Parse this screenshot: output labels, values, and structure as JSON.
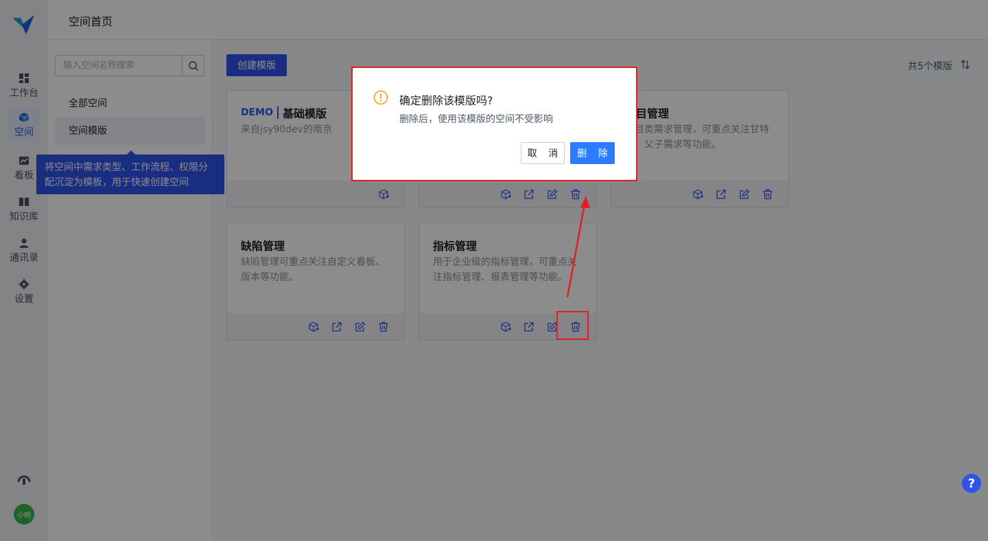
{
  "app": {
    "page_title": "空间首页",
    "avatar_text": "小明"
  },
  "nav": [
    {
      "label": "工作台",
      "icon": "dashboard-icon"
    },
    {
      "label": "空间",
      "icon": "cube-icon",
      "active": true
    },
    {
      "label": "看板",
      "icon": "board-icon"
    },
    {
      "label": "知识库",
      "icon": "book-icon"
    },
    {
      "label": "通讯录",
      "icon": "contacts-icon"
    },
    {
      "label": "设置",
      "icon": "settings-icon"
    }
  ],
  "sidebar": {
    "search_placeholder": "输入空间名称搜索",
    "items": [
      {
        "label": "全部空间"
      },
      {
        "label": "空间模版",
        "active": true
      }
    ]
  },
  "tooltip": {
    "text": "将空间中需求类型、工作流程、权限分配沉淀为模板，用于快速创建空间"
  },
  "main": {
    "create_label": "创建模版",
    "count_text": "共5个模版",
    "cards": [
      {
        "badge": "DEMO",
        "title": "基础模版",
        "desc": "来自jsy90dev的南京"
      },
      {
        "title": "",
        "desc": ""
      },
      {
        "title": "项目管理",
        "desc": "项目类需求管理，可重点关注甘特图、父子需求等功能。"
      },
      {
        "title": "缺陷管理",
        "desc": "缺陷管理可重点关注自定义看板、版本等功能。"
      },
      {
        "title": "指标管理",
        "desc": "用于企业级的指标管理，可重点关注指标管理、报表管理等功能。"
      }
    ]
  },
  "dialog": {
    "title": "确定删除该模版吗?",
    "message": "删除后，使用该模版的空间不受影响",
    "cancel_label": "取 消",
    "confirm_label": "删 除"
  },
  "help_label": "?",
  "colors": {
    "primary": "#2f54eb",
    "confirm": "#2b7cff",
    "warning": "#f5a623",
    "annotation": "#e02020"
  }
}
